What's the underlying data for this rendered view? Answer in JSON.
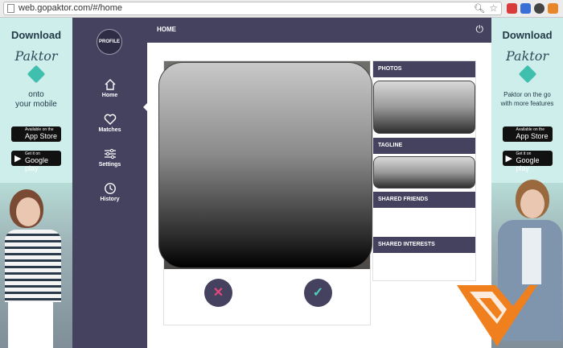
{
  "browser": {
    "url": "web.gopaktor.com/#/home"
  },
  "ad_left": {
    "download": "Download",
    "brand": "Paktor",
    "tagline_line1": "onto",
    "tagline_line2": "your mobile",
    "appstore_small": "Available on the",
    "appstore_big": "App Store",
    "googleplay_small": "Get it on",
    "googleplay_big": "Google play"
  },
  "ad_right": {
    "download": "Download",
    "brand": "Paktor",
    "tagline_line1": "Paktor on the go",
    "tagline_line2": "with more features",
    "appstore_small": "Available on the",
    "appstore_big": "App Store",
    "googleplay_small": "Get it on",
    "googleplay_big": "Google play"
  },
  "sidebar": {
    "profile_label": "PROFILE",
    "items": [
      {
        "label": "Home",
        "icon": "home-icon"
      },
      {
        "label": "Matches",
        "icon": "heart-icon"
      },
      {
        "label": "Settings",
        "icon": "sliders-icon"
      },
      {
        "label": "History",
        "icon": "clock-icon"
      }
    ]
  },
  "header": {
    "title": "HOME",
    "power_icon": "power-icon"
  },
  "panel": {
    "photos": "PHOTOS",
    "tagline": "TAGLINE",
    "shared_friends": "SHARED FRIENDS",
    "shared_interests": "SHARED INTERESTS"
  },
  "actions": {
    "reject_icon": "✕",
    "accept_icon": "✓"
  },
  "colors": {
    "nav": "#45425f",
    "ad_bg": "#cdeeea",
    "accept": "#4fd1b7",
    "reject": "#e6477a",
    "watermark": "#f07f1e"
  }
}
